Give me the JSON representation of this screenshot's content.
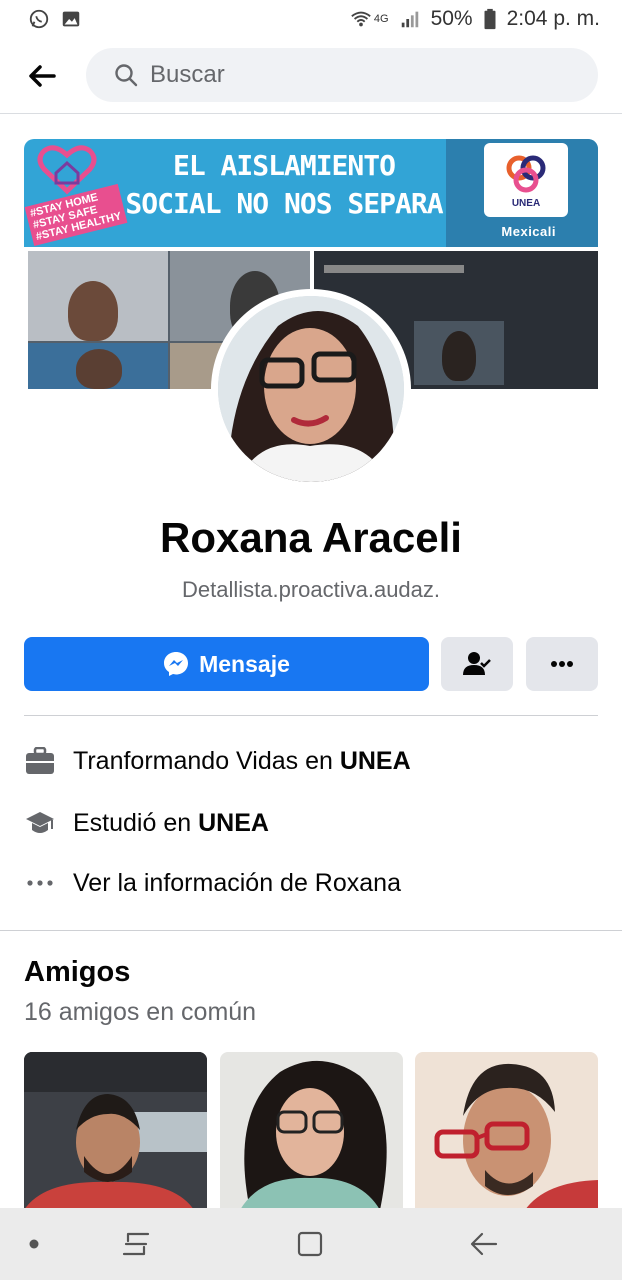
{
  "status_bar": {
    "network": "4G",
    "battery": "50%",
    "time": "2:04 p. m.",
    "icons": [
      "whatsapp-icon",
      "image-icon",
      "wifi-icon",
      "signal-icon",
      "battery-icon"
    ]
  },
  "header": {
    "search_placeholder": "Buscar",
    "icons": [
      "back-arrow-icon",
      "search-icon"
    ]
  },
  "cover": {
    "banner_line1": "EL AISLAMIENTO",
    "banner_line2": "SOCIAL NO NOS SEPARA",
    "tags": [
      "#STAY HOME",
      "#STAY SAFE",
      "#STAY HEALTHY"
    ],
    "logo_text": "UNEA",
    "logo_city": "Mexicali"
  },
  "profile": {
    "name": "Roxana Araceli",
    "bio": "Detallista.proactiva.audaz."
  },
  "actions": {
    "message_label": "Mensaje",
    "icons": [
      "messenger-icon",
      "friend-status-icon",
      "more-options-icon"
    ]
  },
  "info": {
    "work_prefix": "Tranformando Vidas en ",
    "work_org": "UNEA",
    "study_prefix": "Estudió en ",
    "study_org": "UNEA",
    "more_info": "Ver la información de Roxana"
  },
  "friends": {
    "title": "Amigos",
    "subtitle": "16 amigos en común"
  },
  "colors": {
    "accent": "#1877f2",
    "banner": "#32a4d6",
    "secondary_text": "#65676b"
  }
}
